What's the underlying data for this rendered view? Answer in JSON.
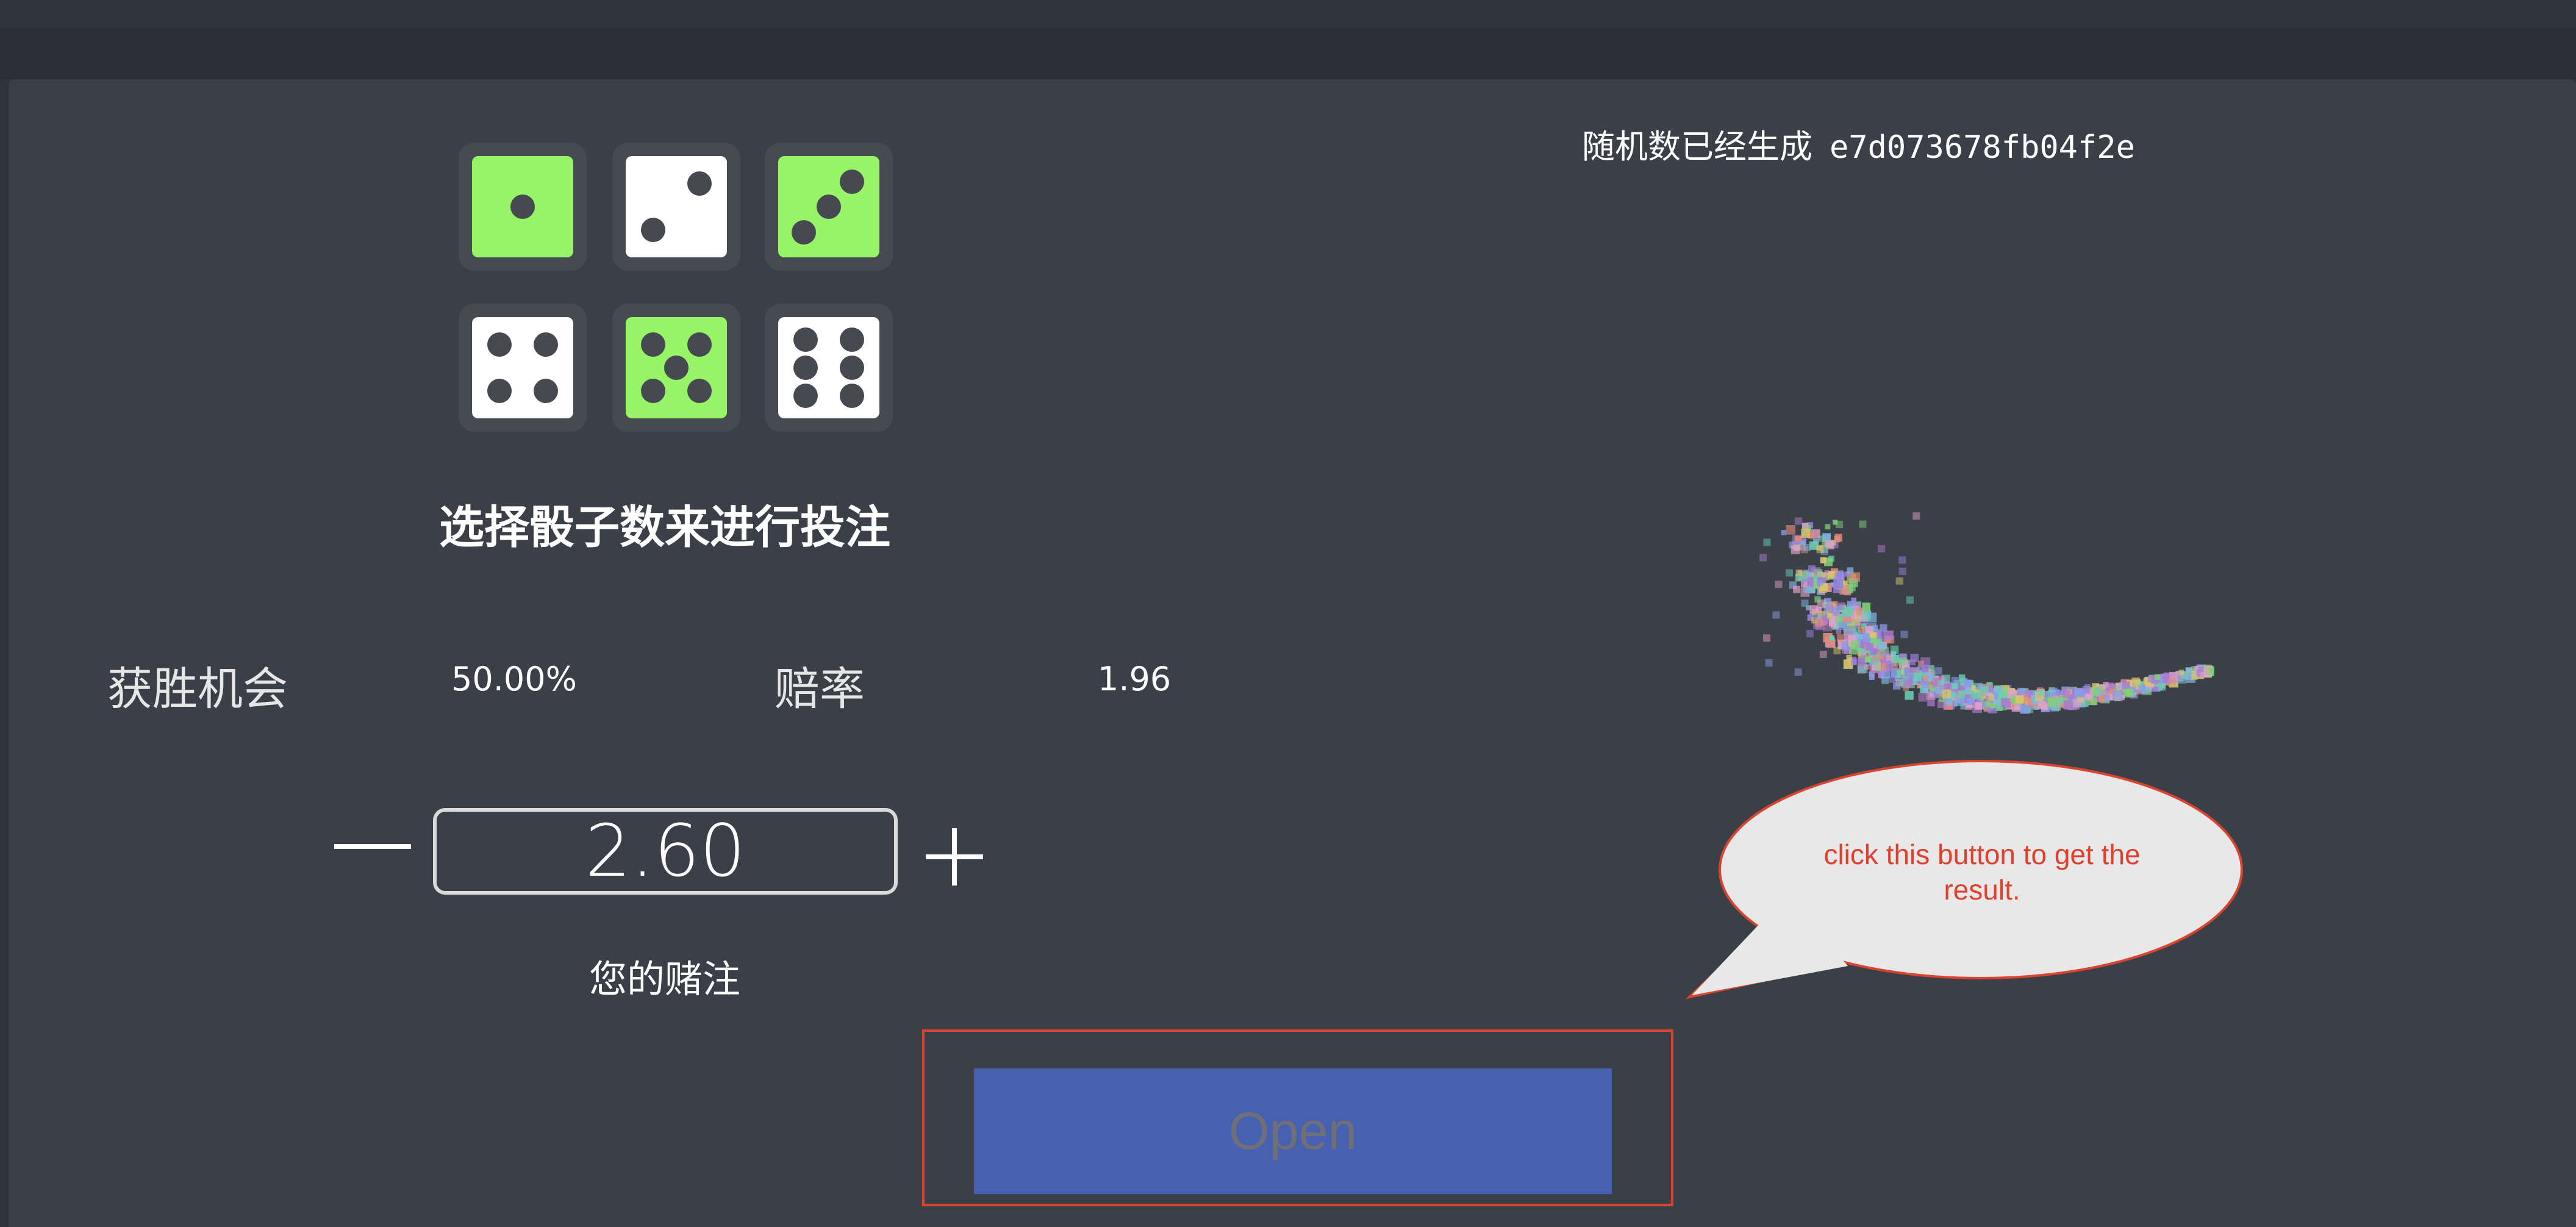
{
  "dice": [
    {
      "face": 1,
      "selected": true
    },
    {
      "face": 2,
      "selected": false
    },
    {
      "face": 3,
      "selected": true
    },
    {
      "face": 4,
      "selected": false
    },
    {
      "face": 5,
      "selected": true
    },
    {
      "face": 6,
      "selected": false
    }
  ],
  "title": "选择骰子数来进行投注",
  "stats": {
    "win_chance_label": "获胜机会",
    "win_chance_value": "50.00%",
    "odds_label": "赔率",
    "odds_value": "1.96"
  },
  "bet": {
    "value": "2.60",
    "label": "您的赌注"
  },
  "open_button_label": "Open",
  "rng": {
    "status": "随机数已经生成",
    "hash": "e7d073678fb04f2e"
  },
  "tooltip": {
    "text": "click this button to get the result."
  },
  "colors": {
    "selected_die": "#96f466",
    "unselected_die": "#ffffff",
    "button": "#4760b0",
    "annotation": "#d9432f"
  },
  "icons": [
    "minus-icon",
    "plus-icon"
  ]
}
